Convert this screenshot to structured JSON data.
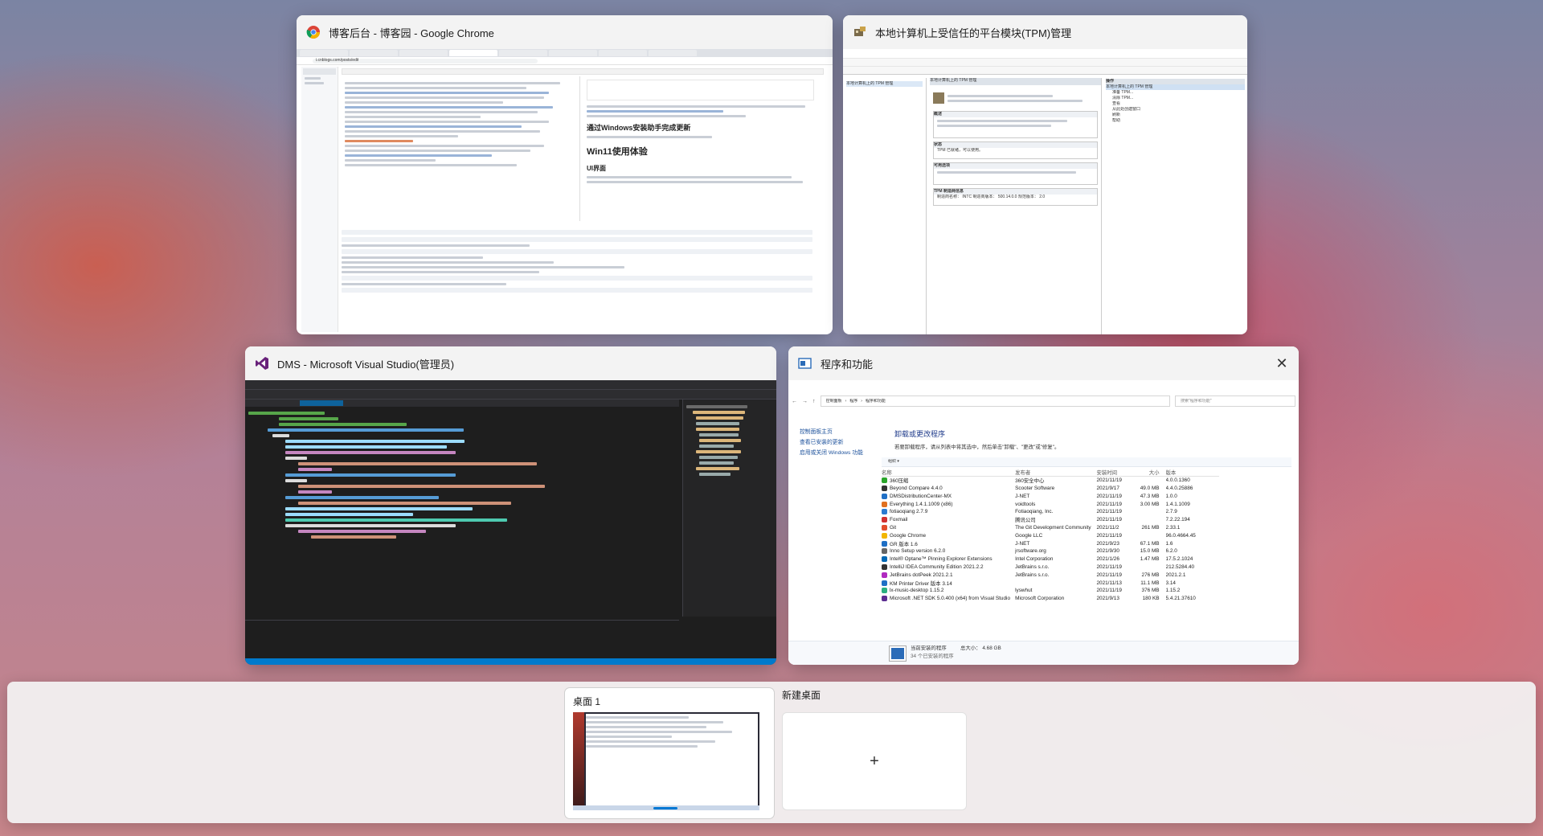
{
  "windows": {
    "chrome": {
      "title": "博客后台 - 博客园 - Google Chrome",
      "url": "i.cnblogs.com/posts/edit",
      "preview_headings": [
        "通过Windows安装助手完成更新",
        "Win11使用体验",
        "UI界面"
      ]
    },
    "tpm": {
      "title": "本地计算机上受信任的平台模块(TPM)管理",
      "inner_header": "本地计算机上的 TPM 管理",
      "sections": [
        "概述",
        "状态",
        "可用选项",
        "TPM 制造商信息"
      ],
      "status_text": "TPM 已就绪，可以使用。",
      "manufacturer": "制造商名称：  INTC     制造商版本：  500.14.0.0     规范版本：  2.0",
      "actions_title": "操作",
      "actions": [
        "准备 TPM...",
        "清除 TPM...",
        "查看",
        "从此处创建窗口",
        "刷新",
        "帮助"
      ]
    },
    "vs": {
      "title": "DMS - Microsoft Visual Studio(管理员)"
    },
    "programs": {
      "title": "程序和功能",
      "breadcrumb": [
        "控制面板",
        "程序",
        "程序和功能"
      ],
      "search_placeholder": "搜索\"程序和功能\"",
      "sidebar": [
        "控制面板主页",
        "查看已安装的更新",
        "启用或关闭 Windows 功能"
      ],
      "heading": "卸载或更改程序",
      "subtext": "若要卸载程序，请从列表中将其选中，然后单击\"卸载\"、\"更改\"或\"修复\"。",
      "organize": "组织 ▾",
      "columns": [
        "名称",
        "发布者",
        "安装时间",
        "大小",
        "版本"
      ],
      "rows": [
        [
          "360压缩",
          "360安全中心",
          "2021/11/19",
          "",
          "4.0.0.1360",
          "#2aa52a"
        ],
        [
          "Beyond Compare 4.4.0",
          "Scooter Software",
          "2021/9/17",
          "49.0 MB",
          "4.4.0.25886",
          "#333"
        ],
        [
          "DMSDistributionCenter-MX",
          "J-NET",
          "2021/11/19",
          "47.3 MB",
          "1.0.0",
          "#1f6fc5"
        ],
        [
          "Everything 1.4.1.1009 (x86)",
          "voidtools",
          "2021/11/19",
          "3.00 MB",
          "1.4.1.1009",
          "#e07020"
        ],
        [
          "fotiaoqiang 2.7.9",
          "Fotiaoqiang, Inc.",
          "2021/11/19",
          "",
          "2.7.9",
          "#2a7ad0"
        ],
        [
          "Foxmail",
          "腾讯公司",
          "2021/11/19",
          "",
          "7.2.22.194",
          "#d03030"
        ],
        [
          "Git",
          "The Git Development Community",
          "2021/11/2",
          "261 MB",
          "2.33.1",
          "#e24d2c"
        ],
        [
          "Google Chrome",
          "Google LLC",
          "2021/11/19",
          "",
          "96.0.4664.45",
          "#f2b600"
        ],
        [
          "GR 版本 1.6",
          "J-NET",
          "2021/9/23",
          "67.1 MB",
          "1.6",
          "#1f6fc5"
        ],
        [
          "Inno Setup version 6.2.0",
          "jrsoftware.org",
          "2021/9/30",
          "15.0 MB",
          "6.2.0",
          "#666"
        ],
        [
          "Intel® Optane™ Pinning Explorer Extensions",
          "Intel Corporation",
          "2021/1/26",
          "1.47 MB",
          "17.5.2.1024",
          "#0068b5"
        ],
        [
          "IntelliJ IDEA Community Edition 2021.2.2",
          "JetBrains s.r.o.",
          "2021/11/19",
          "",
          "212.5284.40",
          "#333"
        ],
        [
          "JetBrains dotPeek 2021.2.1",
          "JetBrains s.r.o.",
          "2021/11/19",
          "276 MB",
          "2021.2.1",
          "#b02ac0"
        ],
        [
          "KM Printer Driver 版本 3.14",
          "",
          "2021/11/13",
          "11.1 MB",
          "3.14",
          "#1f6fc5"
        ],
        [
          "lx-music-desktop 1.15.2",
          "lyswhut",
          "2021/11/19",
          "376 MB",
          "1.15.2",
          "#2ab080"
        ],
        [
          "Microsoft .NET SDK 5.0.400 (x64) from Visual Studio",
          "Microsoft Corporation",
          "2021/9/13",
          "180 KB",
          "5.4.21.37610",
          "#5c2d91"
        ]
      ],
      "footer_label": "当前安装的程序",
      "footer_size": "总大小： 4.68 GB",
      "footer_count": "34 个已安装的程序"
    }
  },
  "taskview": {
    "desktop1": "桌面 1",
    "new_desktop": "新建桌面",
    "plus": "+"
  },
  "colors": {
    "accent": "#0078d4",
    "vs_bg": "#1e1e1e",
    "vs_purple": "#68217a"
  }
}
